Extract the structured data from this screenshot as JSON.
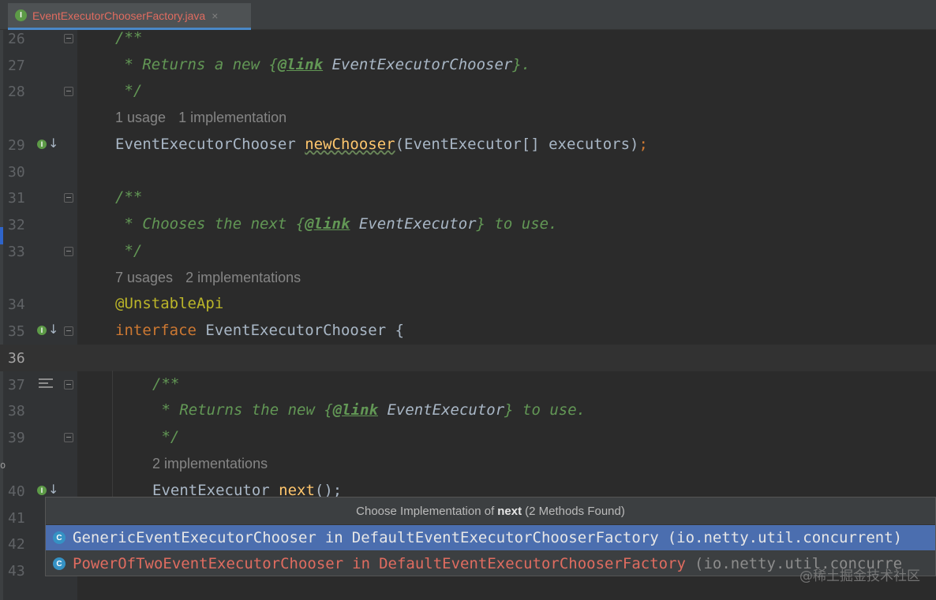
{
  "tab": {
    "title": "EventExecutorChooserFactory.java",
    "icon": "I",
    "close": "×"
  },
  "left_strip_char": "o",
  "lines": {
    "l26": {
      "num": "26",
      "text": "/**"
    },
    "l27": {
      "num": "27",
      "pre": " * Returns a new ",
      "open": "{",
      "tag": "@link",
      "ref": " EventExecutorChooser",
      "close": "}",
      "post": "."
    },
    "l28": {
      "num": "28",
      "text": " */"
    },
    "hint1": {
      "usage": "1 usage",
      "impl": "1 implementation"
    },
    "l29": {
      "num": "29",
      "type": "EventExecutorChooser ",
      "method": "newChooser",
      "params": "(EventExecutor[] executors)",
      "semi": ";"
    },
    "l30": {
      "num": "30"
    },
    "l31": {
      "num": "31",
      "text": "/**"
    },
    "l32": {
      "num": "32",
      "pre": " * Chooses the next ",
      "open": "{",
      "tag": "@link",
      "ref": " EventExecutor",
      "close": "}",
      "post": " to use."
    },
    "l33": {
      "num": "33",
      "text": " */"
    },
    "hint2": {
      "usage": "7 usages",
      "impl": "2 implementations"
    },
    "l34": {
      "num": "34",
      "annotation": "@UnstableApi"
    },
    "l35": {
      "num": "35",
      "keyword": "interface",
      "name": " EventExecutorChooser {"
    },
    "l36": {
      "num": "36"
    },
    "l37": {
      "num": "37",
      "text": "/**"
    },
    "l38": {
      "num": "38",
      "pre": " * Returns the new ",
      "open": "{",
      "tag": "@link",
      "ref": " EventExecutor",
      "close": "}",
      "post": " to use."
    },
    "l39": {
      "num": "39",
      "text": " */"
    },
    "hint3": {
      "impl": "2 implementations"
    },
    "l40": {
      "num": "40",
      "type": "EventExecutor ",
      "method": "next",
      "rest": "();"
    },
    "l41": {
      "num": "41"
    },
    "l42": {
      "num": "42"
    },
    "l43": {
      "num": "43"
    }
  },
  "popup": {
    "title_prefix": "Choose Implementation of",
    "title_method": "next",
    "title_suffix": "(2 Methods Found)",
    "items": [
      {
        "name": "GenericEventExecutorChooser",
        "in": "in",
        "container": "DefaultEventExecutorChooserFactory",
        "package": "(io.netty.util.concurrent)",
        "icon": "C",
        "selected": true
      },
      {
        "name": "PowerOfTwoEventExecutorChooser",
        "in": "in",
        "container": "DefaultEventExecutorChooserFactory",
        "package": "(io.netty.util.concurre",
        "icon": "C",
        "selected": false
      }
    ]
  },
  "watermark": "@稀土掘金技术社区",
  "colors": {
    "comment": "#629755",
    "keyword": "#cc7832",
    "method": "#ffc66d",
    "annotation": "#bbb529",
    "text": "#a9b7c6",
    "selection": "#4b6eaf",
    "error_red": "#e06c60"
  }
}
